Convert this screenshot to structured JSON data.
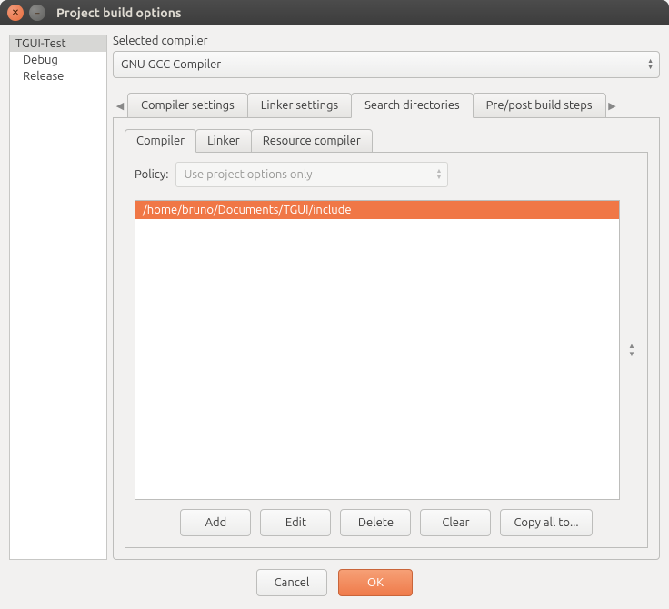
{
  "window": {
    "title": "Project build options"
  },
  "sidebar": {
    "items": [
      {
        "label": "TGUI-Test",
        "selected": true
      },
      {
        "label": "Debug"
      },
      {
        "label": "Release"
      }
    ]
  },
  "compiler": {
    "label": "Selected compiler",
    "value": "GNU GCC Compiler"
  },
  "tabs": {
    "items": [
      {
        "label": "Compiler settings"
      },
      {
        "label": "Linker settings"
      },
      {
        "label": "Search directories",
        "active": true
      },
      {
        "label": "Pre/post build steps"
      }
    ]
  },
  "inner_tabs": {
    "items": [
      {
        "label": "Compiler",
        "active": true
      },
      {
        "label": "Linker"
      },
      {
        "label": "Resource compiler"
      }
    ]
  },
  "policy": {
    "label": "Policy:",
    "value": "Use project options only"
  },
  "directories": {
    "items": [
      {
        "path": "/home/bruno/Documents/TGUI/include",
        "selected": true
      }
    ]
  },
  "buttons": {
    "add": "Add",
    "edit": "Edit",
    "delete": "Delete",
    "clear": "Clear",
    "copy_all": "Copy all to..."
  },
  "footer": {
    "cancel": "Cancel",
    "ok": "OK"
  }
}
